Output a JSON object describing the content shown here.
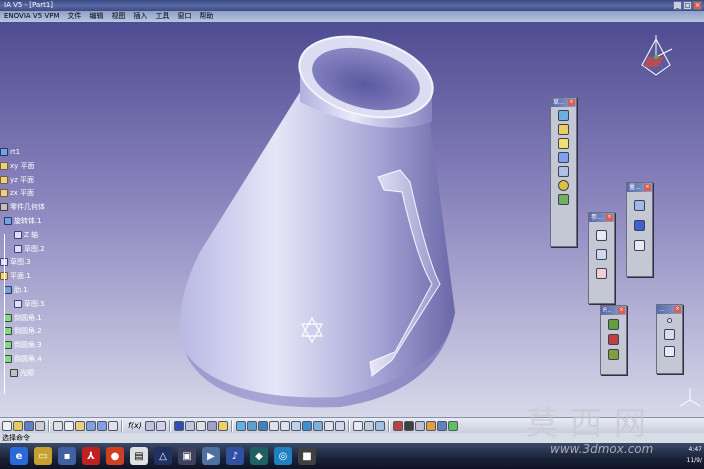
{
  "window": {
    "title": "IA V5 - [Part1]",
    "controls": [
      "_",
      "□",
      "×"
    ]
  },
  "menubar": {
    "items": [
      "ENOVIA V5 VPM",
      "文件",
      "编辑",
      "视图",
      "插入",
      "工具",
      "窗口",
      "帮助"
    ]
  },
  "tree": {
    "items": [
      {
        "label": "rt1",
        "icon": "part-icon"
      },
      {
        "label": "xy 平面",
        "icon": "plane-icon"
      },
      {
        "label": "yz 平面",
        "icon": "plane-icon"
      },
      {
        "label": "zx 平面",
        "icon": "plane-icon"
      },
      {
        "label": "零件几何体",
        "icon": "body-icon"
      },
      {
        "label": "旋转体.1",
        "icon": "shaft-icon"
      },
      {
        "label": "Z 轴",
        "icon": "axis-icon"
      },
      {
        "label": "草图.2",
        "icon": "sketch-icon"
      },
      {
        "label": "草图.3",
        "icon": "sketch-icon"
      },
      {
        "label": "平面.1",
        "icon": "plane-icon"
      },
      {
        "label": "肋.1",
        "icon": "rib-icon"
      },
      {
        "label": "草图.5",
        "icon": "sketch-icon"
      },
      {
        "label": "倒圆角.1",
        "icon": "fillet-icon"
      },
      {
        "label": "倒圆角.2",
        "icon": "fillet-icon"
      },
      {
        "label": "倒圆角.3",
        "icon": "fillet-icon"
      },
      {
        "label": "倒圆角.4",
        "icon": "fillet-icon"
      },
      {
        "label": "光顺",
        "icon": "smooth-icon"
      }
    ]
  },
  "floating_toolbars": [
    {
      "title": "草...",
      "icons": [
        "sketch-icon",
        "cube-icon",
        "pad-icon",
        "pocket-icon",
        "shaft-icon",
        "sphere-icon",
        "hole-icon"
      ]
    },
    {
      "title": "参...",
      "icons": [
        "axis-icon",
        "line-icon",
        "point-icon"
      ]
    },
    {
      "title": "量...",
      "icons": [
        "measure-icon",
        "grid-icon",
        "snap-icon"
      ]
    },
    {
      "title": "P...",
      "icons": [
        "apply-material-icon",
        "appearance-icon",
        "texture-icon"
      ]
    },
    {
      "title": "...",
      "icons": [
        "dot-icon",
        "line-icon",
        "plane-icon"
      ]
    }
  ],
  "bottom_toolbar": {
    "formula_label": "f(x)"
  },
  "status": {
    "text": "选择命令"
  },
  "clock": {
    "time": "4:47",
    "date": "11/9/"
  },
  "watermark": {
    "text": "莫西网",
    "url": "www.3dmox.com"
  },
  "colors": {
    "viewport_top": "#4e4c92",
    "viewport_bottom": "#d8d8ea",
    "part_surface": "#b4b4e0",
    "accent": "#5a6aa8"
  }
}
